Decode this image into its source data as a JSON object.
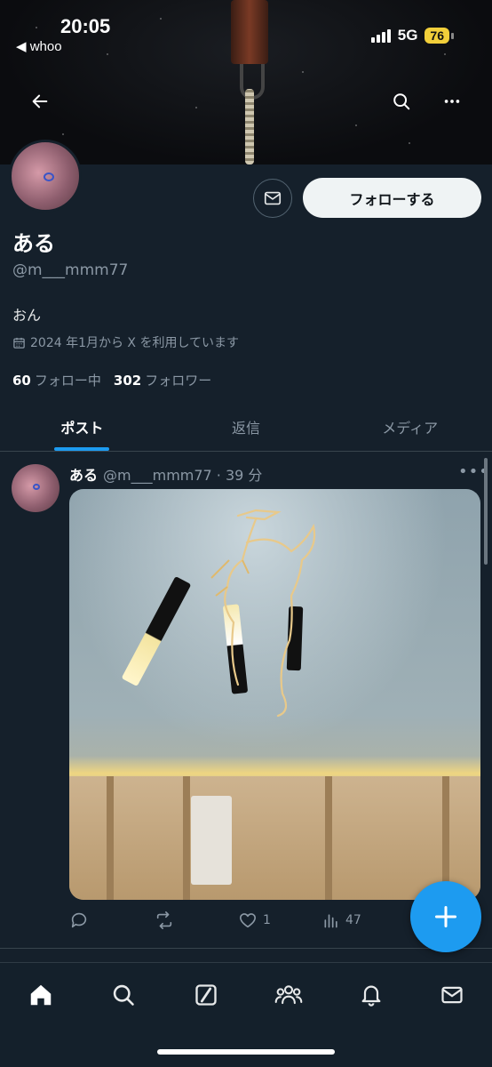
{
  "status_bar": {
    "time": "20:05",
    "back_app": "◀ whoo",
    "network": "5G",
    "battery": "76"
  },
  "profile": {
    "name": "ある",
    "handle": "@m___mmm77",
    "bio": "おん",
    "joined": "2024 年1月から X を利用しています",
    "following_count": "60",
    "following_label": "フォロー中",
    "followers_count": "302",
    "followers_label": "フォロワー",
    "follow_button": "フォローする"
  },
  "tabs": [
    {
      "label": "ポスト",
      "active": true
    },
    {
      "label": "返信",
      "active": false
    },
    {
      "label": "メディア",
      "active": false
    }
  ],
  "post": {
    "name": "ある",
    "handle_time": "@m___mmm77 · 39 分",
    "more": "•••",
    "replies": "",
    "reposts": "",
    "likes": "1",
    "views": "47"
  },
  "icons": {
    "back": "arrow-left-icon",
    "search": "search-icon",
    "more": "more-icon",
    "message": "envelope-icon",
    "calendar": "calendar-icon",
    "reply": "reply-icon",
    "repost": "repost-icon",
    "like": "heart-icon",
    "views": "bar-chart-icon",
    "compose": "plus-icon",
    "nav": [
      "home-icon",
      "search-icon",
      "grok-icon",
      "communities-icon",
      "bell-icon",
      "envelope-icon"
    ]
  },
  "colors": {
    "background": "#15202b",
    "accent": "#1d9bf0",
    "text_secondary": "#8b98a5",
    "battery": "#f2cf3a"
  }
}
